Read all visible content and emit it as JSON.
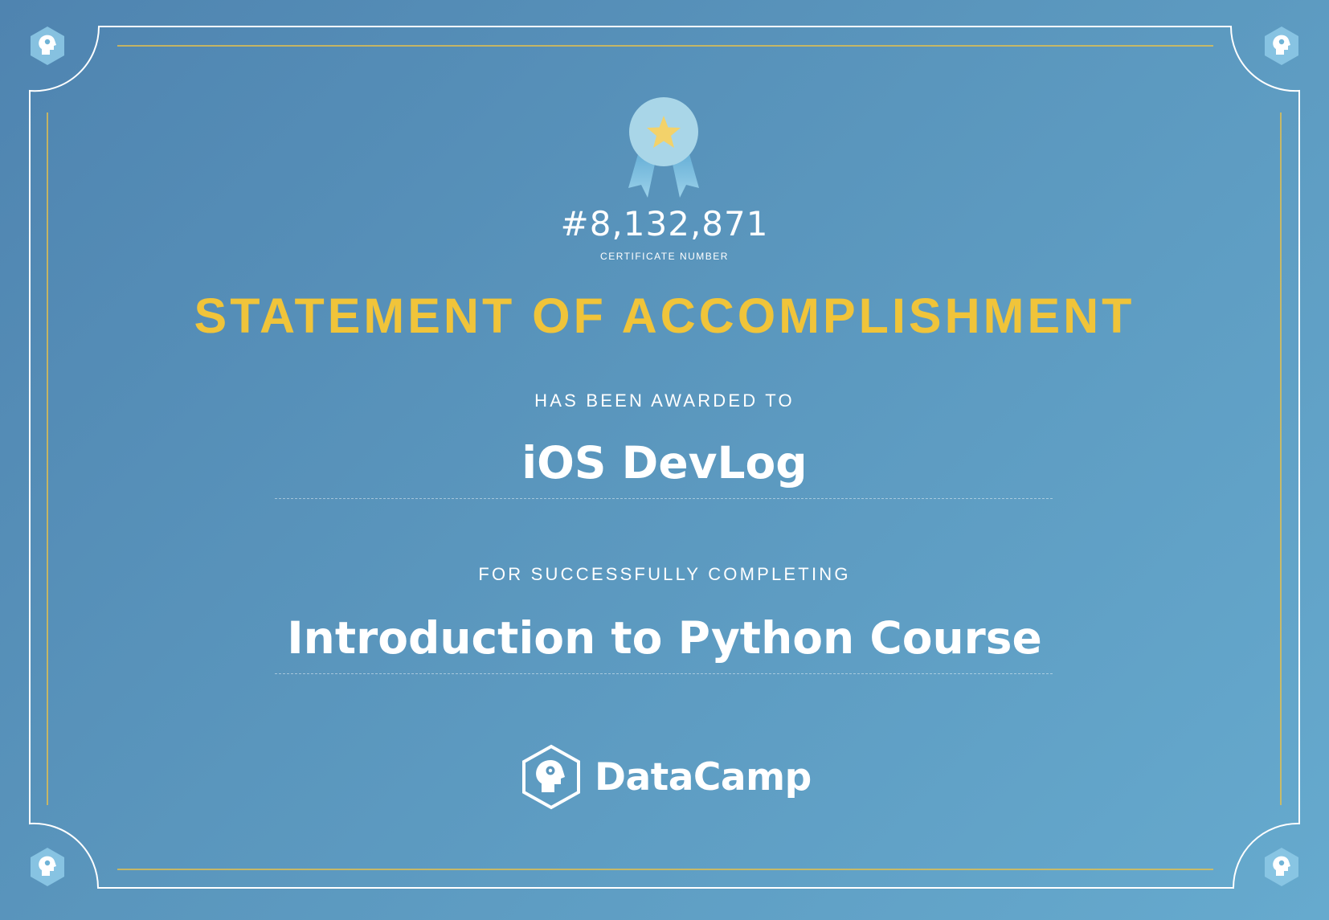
{
  "certificate": {
    "number": "#8,132,871",
    "number_label": "CERTIFICATE NUMBER",
    "title": "STATEMENT OF ACCOMPLISHMENT",
    "awarded_label": "HAS BEEN AWARDED TO",
    "recipient": "iOS DevLog",
    "completing_label": "FOR SUCCESSFULLY COMPLETING",
    "course": "Introduction to Python Course"
  },
  "brand": {
    "name": "DataCamp",
    "logo_icon": "datacamp-head-icon"
  },
  "decor": {
    "medal_icon": "award-ribbon-star-icon",
    "corner_icon": "datacamp-head-icon"
  },
  "colors": {
    "background": "#5a96bd",
    "title_gold": "#f0c43a",
    "text": "#ffffff",
    "frame_gold": "#e9c24a"
  }
}
